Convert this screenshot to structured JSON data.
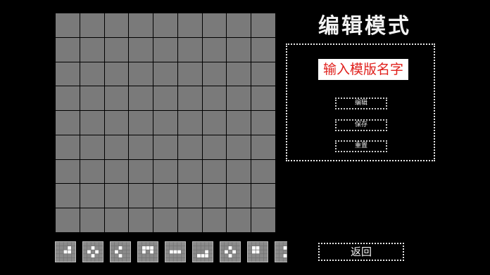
{
  "title": "编辑模式",
  "board": {
    "rows": 9,
    "cols": 9
  },
  "panel": {
    "name_placeholder": "输入模版名字",
    "buttons": [
      "编辑",
      "保存",
      "重置"
    ]
  },
  "palette": [
    {
      "name": "pattern-1-icon",
      "cells": [
        [
          1,
          3
        ],
        [
          2,
          2
        ],
        [
          2,
          3
        ]
      ]
    },
    {
      "name": "pattern-2-icon",
      "cells": [
        [
          1,
          2
        ],
        [
          2,
          1
        ],
        [
          2,
          3
        ],
        [
          3,
          2
        ]
      ]
    },
    {
      "name": "pattern-3-icon",
      "cells": [
        [
          1,
          2
        ],
        [
          2,
          1
        ],
        [
          3,
          2
        ]
      ]
    },
    {
      "name": "pattern-4-icon",
      "cells": [
        [
          1,
          1
        ],
        [
          1,
          2
        ],
        [
          1,
          3
        ],
        [
          2,
          1
        ],
        [
          2,
          3
        ]
      ]
    },
    {
      "name": "pattern-5-icon",
      "cells": [
        [
          2,
          1
        ],
        [
          2,
          2
        ],
        [
          2,
          3
        ]
      ]
    },
    {
      "name": "pattern-6-icon",
      "cells": [
        [
          2,
          3
        ],
        [
          3,
          1
        ],
        [
          3,
          2
        ],
        [
          3,
          3
        ]
      ]
    },
    {
      "name": "pattern-7-icon",
      "cells": [
        [
          1,
          2
        ],
        [
          2,
          1
        ],
        [
          2,
          3
        ],
        [
          3,
          2
        ]
      ]
    },
    {
      "name": "pattern-8-icon",
      "cells": [
        [
          1,
          1
        ],
        [
          1,
          2
        ],
        [
          2,
          1
        ],
        [
          2,
          2
        ]
      ]
    },
    {
      "name": "pattern-9-icon",
      "cells": [
        [
          1,
          2
        ],
        [
          3,
          2
        ]
      ]
    }
  ],
  "back_label": "返回"
}
